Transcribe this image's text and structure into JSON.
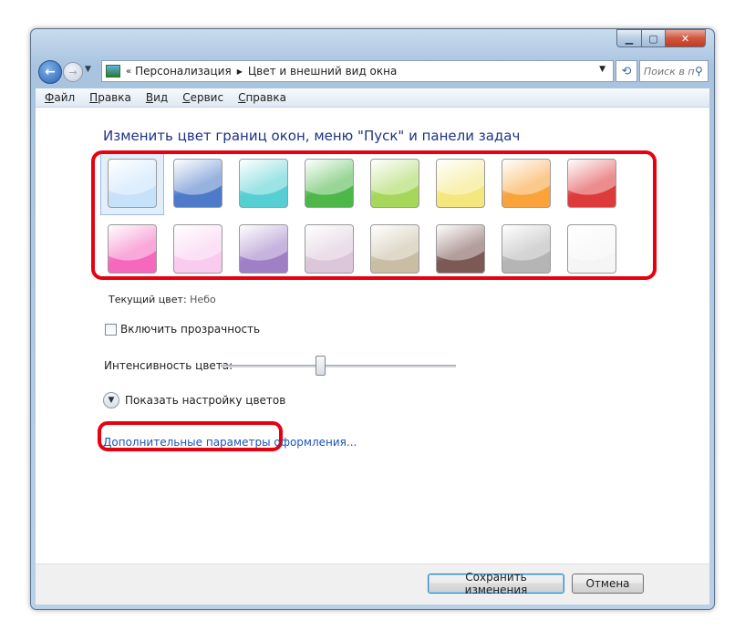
{
  "address_bar": {
    "crumbs": [
      "Персонализация",
      "Цвет и внешний вид окна"
    ],
    "search_placeholder": "Поиск в па..."
  },
  "menu": [
    "Файл",
    "Правка",
    "Вид",
    "Сервис",
    "Справка"
  ],
  "page": {
    "title": "Изменить цвет границ окон, меню \"Пуск\" и панели задач",
    "current_color_label": "Текущий цвет:",
    "current_color_value": "Небо",
    "transparency_label": "Включить прозрачность",
    "transparency_checked": false,
    "intensity_label": "Интенсивность цвета:",
    "intensity_level": 0.42,
    "show_colors_label": "Показать настройку цветов",
    "advanced_link": "Дополнительные параметры оформления..."
  },
  "swatches": {
    "selected_index": 0,
    "colors": [
      "#c6e2fb",
      "#4d7ac9",
      "#55cfd3",
      "#4eb74a",
      "#a6d75a",
      "#f4e77d",
      "#f9a33a",
      "#dd3a3c",
      "#f668bd",
      "#f9cbef",
      "#9f7fc6",
      "#dcc7da",
      "#c9bea4",
      "#7c5955",
      "#b5b5b5",
      "#f5f5f5"
    ]
  },
  "footer": {
    "save_label": "Сохранить изменения",
    "cancel_label": "Отмена"
  },
  "highlight_color": "#e8000e"
}
